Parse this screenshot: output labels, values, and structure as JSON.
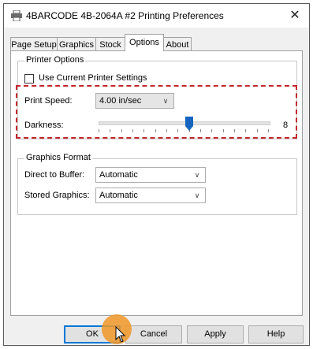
{
  "window": {
    "title": "4BARCODE 4B-2064A #2 Printing Preferences",
    "close_icon": "close-icon",
    "app_icon": "printer-icon"
  },
  "tabs": [
    {
      "label": "Page Setup",
      "active": false
    },
    {
      "label": "Graphics",
      "active": false
    },
    {
      "label": "Stock",
      "active": false
    },
    {
      "label": "Options",
      "active": true
    },
    {
      "label": "About",
      "active": false
    }
  ],
  "printer_options": {
    "group_label": "Printer Options",
    "use_current_settings_label": "Use Current Printer Settings",
    "use_current_settings_checked": false,
    "print_speed_label": "Print Speed:",
    "print_speed_value": "4.00 in/sec",
    "darkness_label": "Darkness:",
    "darkness_value": "8",
    "darkness_min": 0,
    "darkness_max": 15
  },
  "graphics_format": {
    "group_label": "Graphics Format",
    "direct_to_buffer_label": "Direct to Buffer:",
    "direct_to_buffer_value": "Automatic",
    "stored_graphics_label": "Stored Graphics:",
    "stored_graphics_value": "Automatic"
  },
  "buttons": {
    "ok": "OK",
    "cancel": "Cancel",
    "apply": "Apply",
    "help": "Help"
  },
  "colors": {
    "highlight_dashed": "#c4272e",
    "slider_thumb": "#1565c0",
    "cursor_circle": "#f09628",
    "default_button_border": "#0078d7"
  }
}
